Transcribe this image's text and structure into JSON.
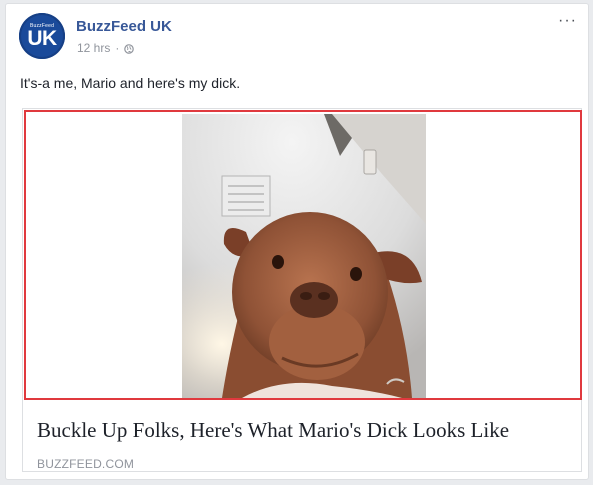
{
  "post": {
    "page_name": "BuzzFeed UK",
    "timestamp": "12 hrs",
    "separator": "·",
    "text": "It's-a me, Mario and here's my dick.",
    "avatar": {
      "top_text": "BuzzFeed",
      "main_text": "UK",
      "color": "#1a4a9a"
    },
    "privacy_icon": "globe-icon",
    "more_icon": "more-options-icon",
    "more_label": "···"
  },
  "link_card": {
    "title": "Buckle Up Folks, Here's What Mario's Dick Looks Like",
    "domain": "BUZZFEED.COM",
    "image": "photo of a brown dog looking down at the camera",
    "highlight_color": "#e0393e"
  },
  "colors": {
    "link_blue": "#385898",
    "meta_grey": "#90949c",
    "text": "#1d2129"
  }
}
